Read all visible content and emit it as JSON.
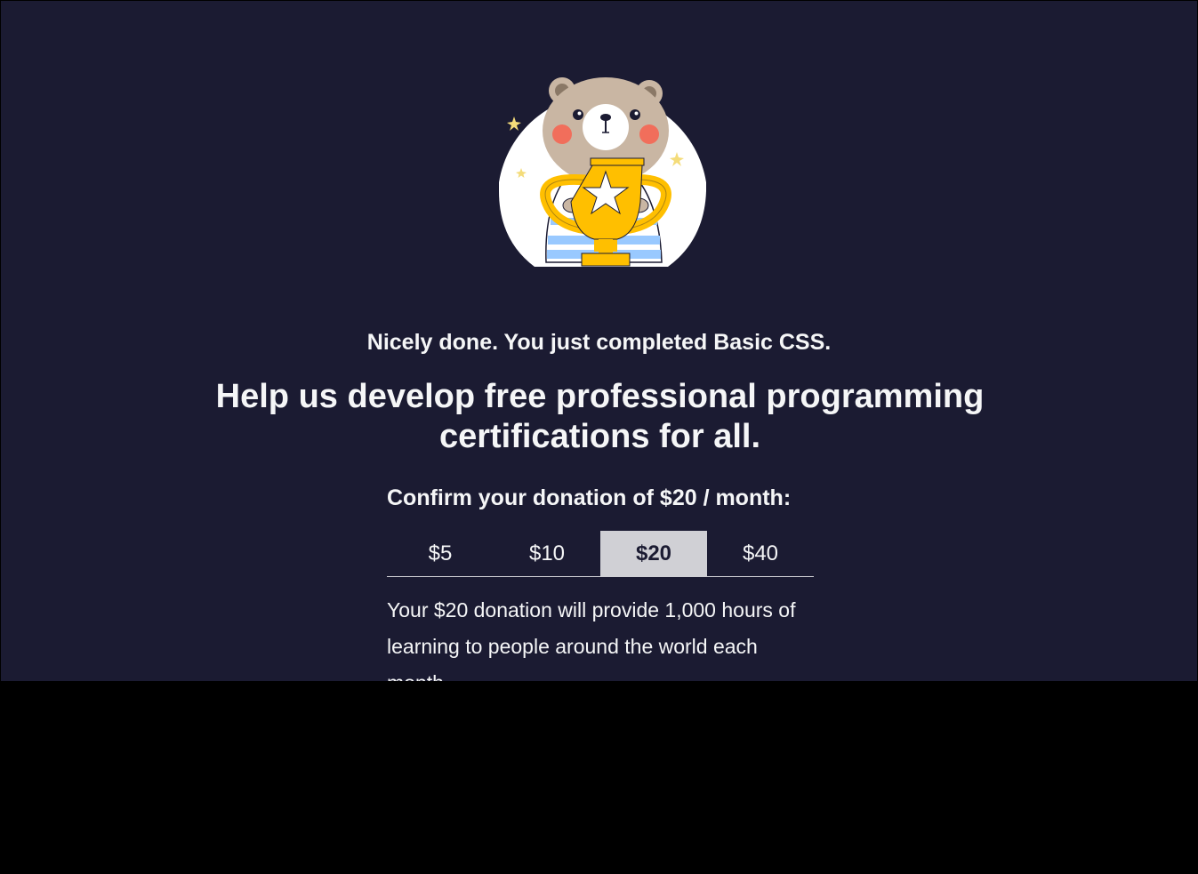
{
  "modal": {
    "completed_text": "Nicely done. You just completed Basic CSS.",
    "headline": "Help us develop free professional programming certifications for all.",
    "confirm_text": "Confirm your donation of $20 / month:",
    "amounts": [
      {
        "label": "$5",
        "selected": false
      },
      {
        "label": "$10",
        "selected": false
      },
      {
        "label": "$20",
        "selected": true
      },
      {
        "label": "$40",
        "selected": false
      }
    ],
    "impact_text": "Your $20 donation will provide 1,000 hours of learning to people around the world each month.",
    "illustration": "bear-holding-trophy-icon"
  },
  "colors": {
    "background": "#1b1b32",
    "text": "#f5f6f7",
    "tab_selected_bg": "#d0d0d5",
    "trophy": "#ffbf00"
  }
}
